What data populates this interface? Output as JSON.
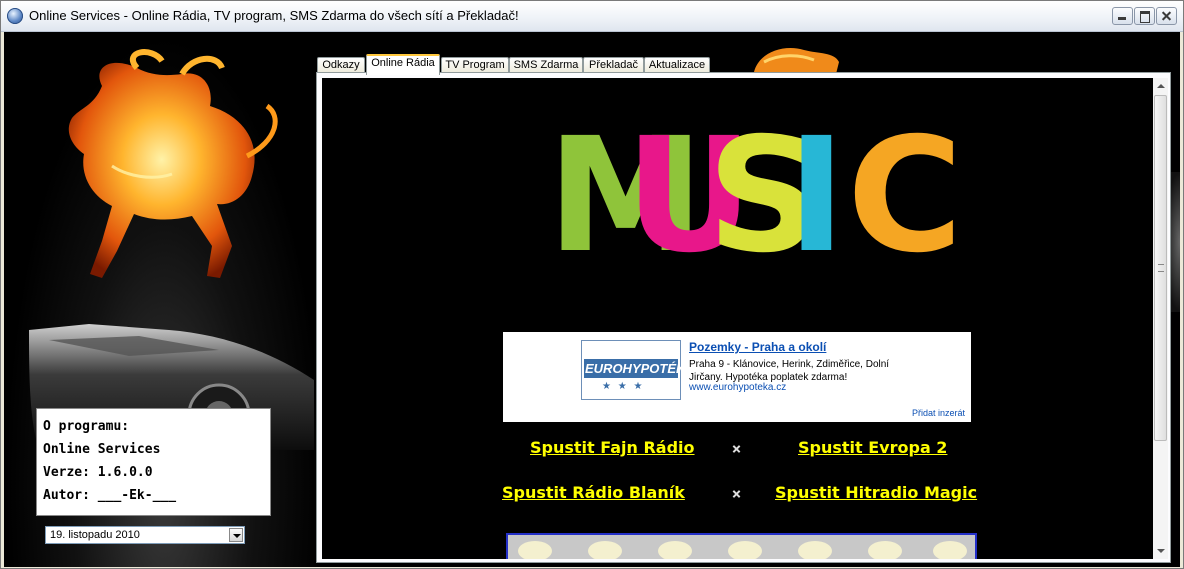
{
  "window": {
    "title": "Online Services - Online Rádia, TV program, SMS Zdarma do všech sítí a Překladač!"
  },
  "tabs": [
    {
      "label": "Odkazy",
      "active": false
    },
    {
      "label": "Online Rádia",
      "active": true
    },
    {
      "label": "TV Program",
      "active": false
    },
    {
      "label": "SMS Zdarma",
      "active": false
    },
    {
      "label": "Překladač",
      "active": false
    },
    {
      "label": "Aktualizace",
      "active": false
    }
  ],
  "info": {
    "line1": "O programu:",
    "line2": "Online Services",
    "line3": "Verze: 1.6.0.0",
    "line4": "Autor: ___-Ek-___"
  },
  "date_select": {
    "value": "19. listopadu 2010"
  },
  "banner": {
    "letters": [
      "M",
      "U",
      "S",
      "I",
      "C"
    ],
    "colors": [
      "#8fc43a",
      "#e8178a",
      "#d9e23a",
      "#27b7d6",
      "#f5a623"
    ]
  },
  "ad": {
    "logo_text": "EUROHYPOTÉKA",
    "title": "Pozemky - Praha a okolí",
    "desc": "Praha 9 - Klánovice, Herink, Zdiměřice, Dolní Jirčany. Hypotéka poplatek zdarma!",
    "url": "www.eurohypoteka.cz",
    "add_label": "Přidat inzerát"
  },
  "radios": {
    "r1": "Spustit Fajn Rádio",
    "r2": "Spustit Evropa 2",
    "r3": "Spustit Rádio Blaník",
    "r4": "Spustit Hitradio Magic"
  }
}
